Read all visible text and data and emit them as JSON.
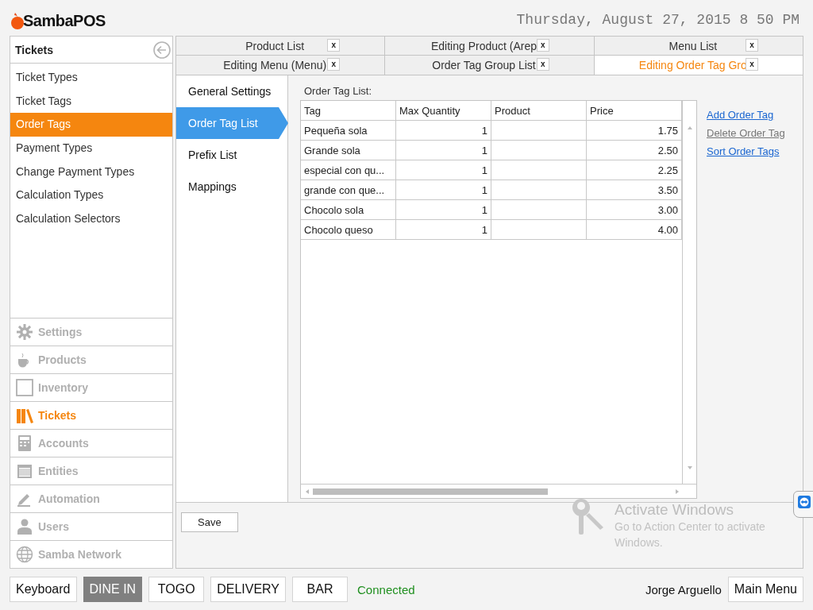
{
  "header": {
    "logo": "SambaPOS",
    "datetime": "Thursday, August 27, 2015 8 50 PM"
  },
  "sidebar": {
    "title": "Tickets",
    "items": [
      {
        "label": "Ticket Types",
        "selected": false
      },
      {
        "label": "Ticket Tags",
        "selected": false
      },
      {
        "label": "Order Tags",
        "selected": true
      },
      {
        "label": "Payment Types",
        "selected": false
      },
      {
        "label": "Change Payment Types",
        "selected": false
      },
      {
        "label": "Calculation Types",
        "selected": false
      },
      {
        "label": "Calculation Selectors",
        "selected": false
      }
    ],
    "modules": [
      {
        "label": "Settings",
        "selected": false
      },
      {
        "label": "Products",
        "selected": false
      },
      {
        "label": "Inventory",
        "selected": false
      },
      {
        "label": "Tickets",
        "selected": true
      },
      {
        "label": "Accounts",
        "selected": false
      },
      {
        "label": "Entities",
        "selected": false
      },
      {
        "label": "Automation",
        "selected": false
      },
      {
        "label": "Users",
        "selected": false
      },
      {
        "label": "Samba Network",
        "selected": false
      }
    ]
  },
  "tabs": [
    {
      "label": "Product List",
      "close": "x",
      "selected": false
    },
    {
      "label": "Editing Product (Arep",
      "close": "x",
      "selected": false
    },
    {
      "label": "Menu List",
      "close": "x",
      "selected": false
    },
    {
      "label": "Editing Menu (Menu)",
      "close": "x",
      "selected": false
    },
    {
      "label": "Order Tag Group List",
      "close": "x",
      "selected": false
    },
    {
      "label": "Editing Order Tag Gro",
      "close": "x",
      "selected": true
    }
  ],
  "sections": [
    {
      "label": "General Settings",
      "selected": false
    },
    {
      "label": "Order Tag List",
      "selected": true
    },
    {
      "label": "Prefix List",
      "selected": false
    },
    {
      "label": "Mappings",
      "selected": false
    }
  ],
  "table": {
    "caption": "Order Tag List:",
    "columns": [
      "Tag",
      "Max Quantity",
      "Product",
      "Price"
    ],
    "rows": [
      [
        "Pequeña sola",
        "1",
        "",
        "1.75"
      ],
      [
        "Grande sola",
        "1",
        "",
        "2.50"
      ],
      [
        "especial con qu...",
        "1",
        "",
        "2.25"
      ],
      [
        "grande con que...",
        "1",
        "",
        "3.50"
      ],
      [
        "Chocolo sola",
        "1",
        "",
        "3.00"
      ],
      [
        "Chocolo queso",
        "1",
        "",
        "4.00"
      ]
    ]
  },
  "links": [
    {
      "label": "Add Order Tag",
      "disabled": false
    },
    {
      "label": "Delete Order Tag",
      "disabled": true
    },
    {
      "label": "Sort Order Tags",
      "disabled": false
    }
  ],
  "save_button": "Save",
  "bottom_bar": {
    "buttons": [
      {
        "label": "Keyboard",
        "selected": false
      },
      {
        "label": "DINE IN",
        "selected": true
      },
      {
        "label": "TOGO",
        "selected": false
      },
      {
        "label": "DELIVERY",
        "selected": false
      },
      {
        "label": "BAR",
        "selected": false
      }
    ],
    "status": "Connected",
    "user": "Jorge Arguello",
    "main_menu": "Main Menu"
  },
  "activation_notice": {
    "title": "Activate Windows",
    "text": "Go to Action Center to activate Windows."
  }
}
